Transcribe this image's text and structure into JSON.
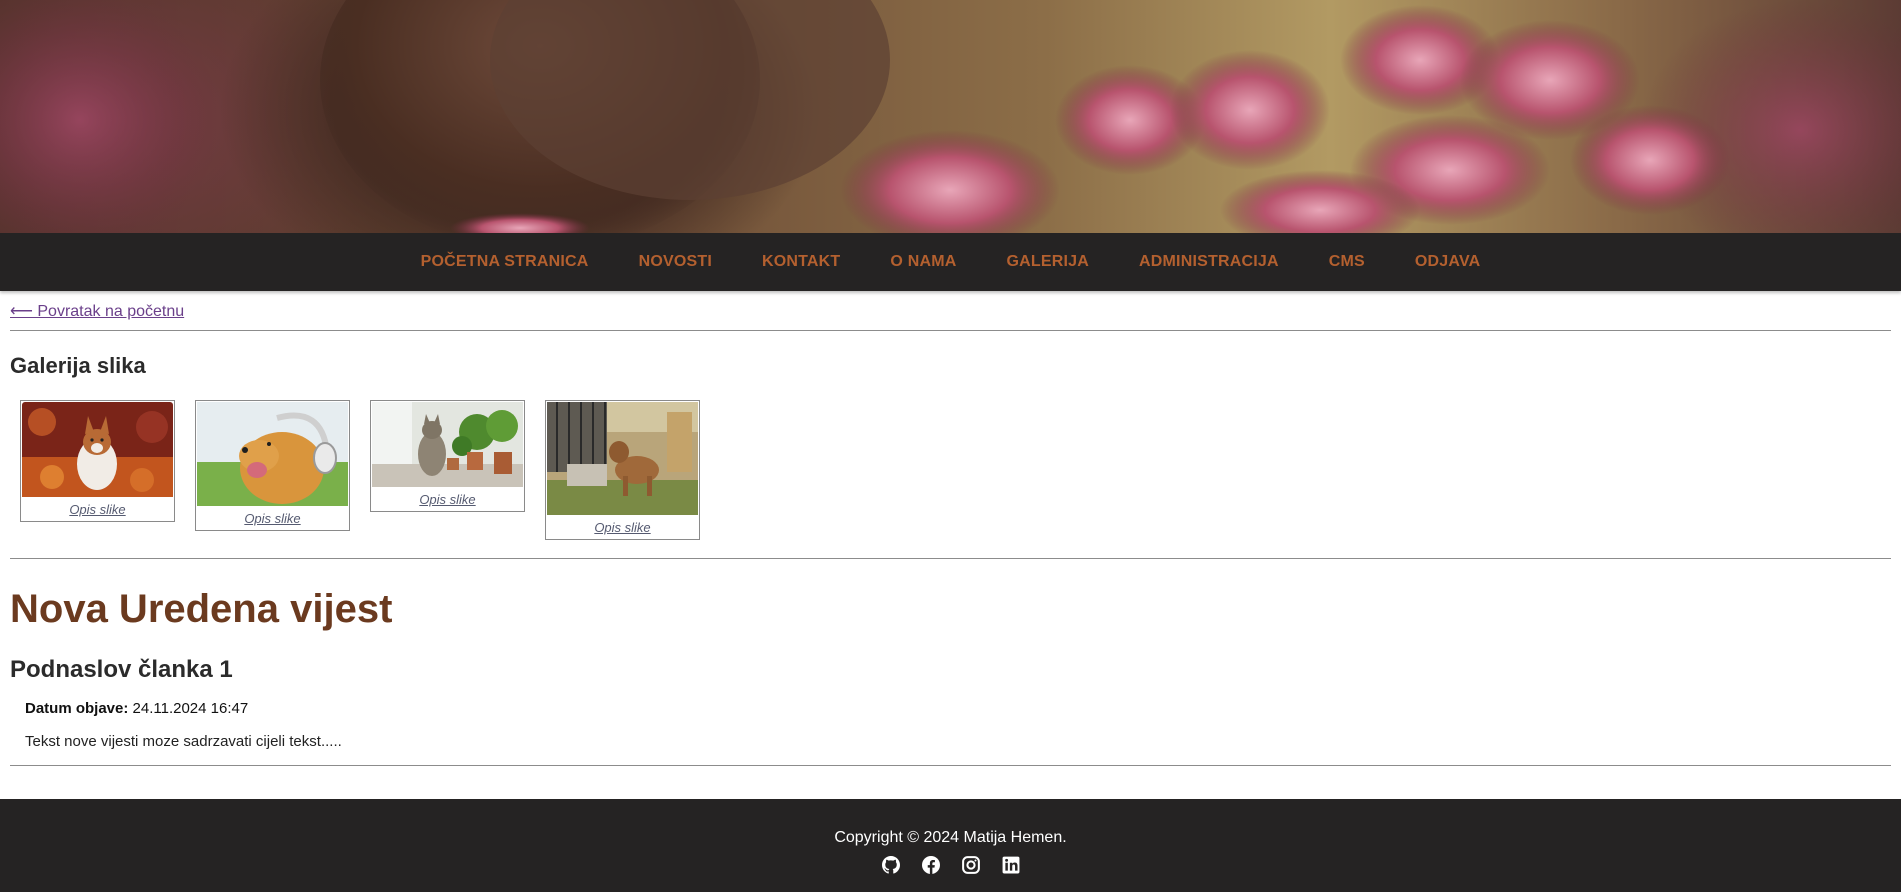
{
  "nav": {
    "items": [
      "POČETNA STRANICA",
      "NOVOSTI",
      "KONTAKT",
      "O NAMA",
      "GALERIJA",
      "ADMINISTRACIJA",
      "CMS",
      "ODJAVA"
    ]
  },
  "back_link": "⟵ Povratak na početnu",
  "gallery": {
    "title": "Galerija slika",
    "items": [
      {
        "caption": "Opis slike",
        "icon": "corgi-photo"
      },
      {
        "caption": "Opis slike",
        "icon": "golden-retriever-headphones-photo"
      },
      {
        "caption": "Opis slike",
        "icon": "cat-with-plants-photo"
      },
      {
        "caption": "Opis slike",
        "icon": "dog-in-yard-photo"
      }
    ]
  },
  "article": {
    "title": "Nova Uredena vijest",
    "subtitle": "Podnaslov članka 1",
    "date_label": "Datum objave:",
    "date_value": "24.11.2024 16:47",
    "body": "Tekst nove vijesti moze sadrzavati cijeli tekst....."
  },
  "footer": {
    "copyright": "Copyright © 2024 Matija Hemen.",
    "social": [
      "github-icon",
      "facebook-icon",
      "instagram-icon",
      "linkedin-icon"
    ]
  },
  "colors": {
    "nav_bg": "#252323",
    "nav_link": "#b4602f",
    "title_brown": "#6b3a1f",
    "footer_bg": "#252323"
  }
}
